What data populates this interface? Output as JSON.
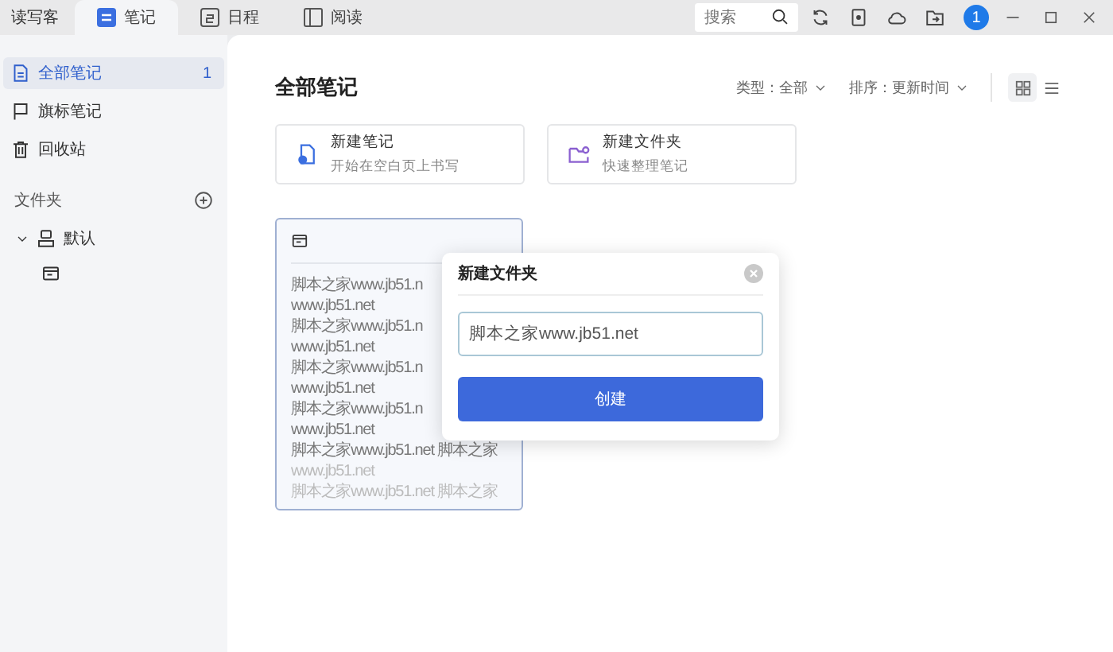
{
  "app_name": "读写客",
  "tabs": [
    {
      "label": "笔记",
      "kind": "note",
      "selected": true
    },
    {
      "label": "日程",
      "kind": "calendar",
      "selected": false
    },
    {
      "label": "阅读",
      "kind": "read",
      "selected": false
    }
  ],
  "search": {
    "placeholder": "搜索"
  },
  "notification_count": "1",
  "sidebar": {
    "items": [
      {
        "label": "全部笔记",
        "kind": "doc",
        "count": "1",
        "selected": true
      },
      {
        "label": "旗标笔记",
        "kind": "flag",
        "selected": false
      },
      {
        "label": "回收站",
        "kind": "trash",
        "selected": false
      }
    ],
    "folders_label": "文件夹",
    "folders": [
      {
        "label": "默认",
        "expanded": true,
        "children": [
          {
            "kind": "notebook"
          }
        ]
      }
    ]
  },
  "main": {
    "title": "全部笔记",
    "filters": [
      {
        "label": "类型：全部"
      },
      {
        "label": "排序：更新时间"
      }
    ],
    "view_modes": [
      {
        "kind": "grid",
        "selected": true
      },
      {
        "kind": "list",
        "selected": false
      }
    ],
    "actions": [
      {
        "kind": "note",
        "title": "新建笔记",
        "subtitle": "开始在空白页上书写"
      },
      {
        "kind": "folder",
        "title": "新建文件夹",
        "subtitle": "快速整理笔记"
      }
    ],
    "note_card": {
      "lines": [
        "脚本之家www.jb51.n",
        "www.jb51.net",
        "脚本之家www.jb51.n",
        "www.jb51.net",
        "脚本之家www.jb51.n",
        "www.jb51.net",
        "脚本之家www.jb51.n",
        "www.jb51.net",
        "脚本之家www.jb51.net 脚本之家",
        "www.jb51.net",
        "脚本之家www.jb51.net 脚本之家"
      ]
    }
  },
  "dialog": {
    "title": "新建文件夹",
    "input_value": "脚本之家www.jb51.net",
    "button": "创建"
  }
}
